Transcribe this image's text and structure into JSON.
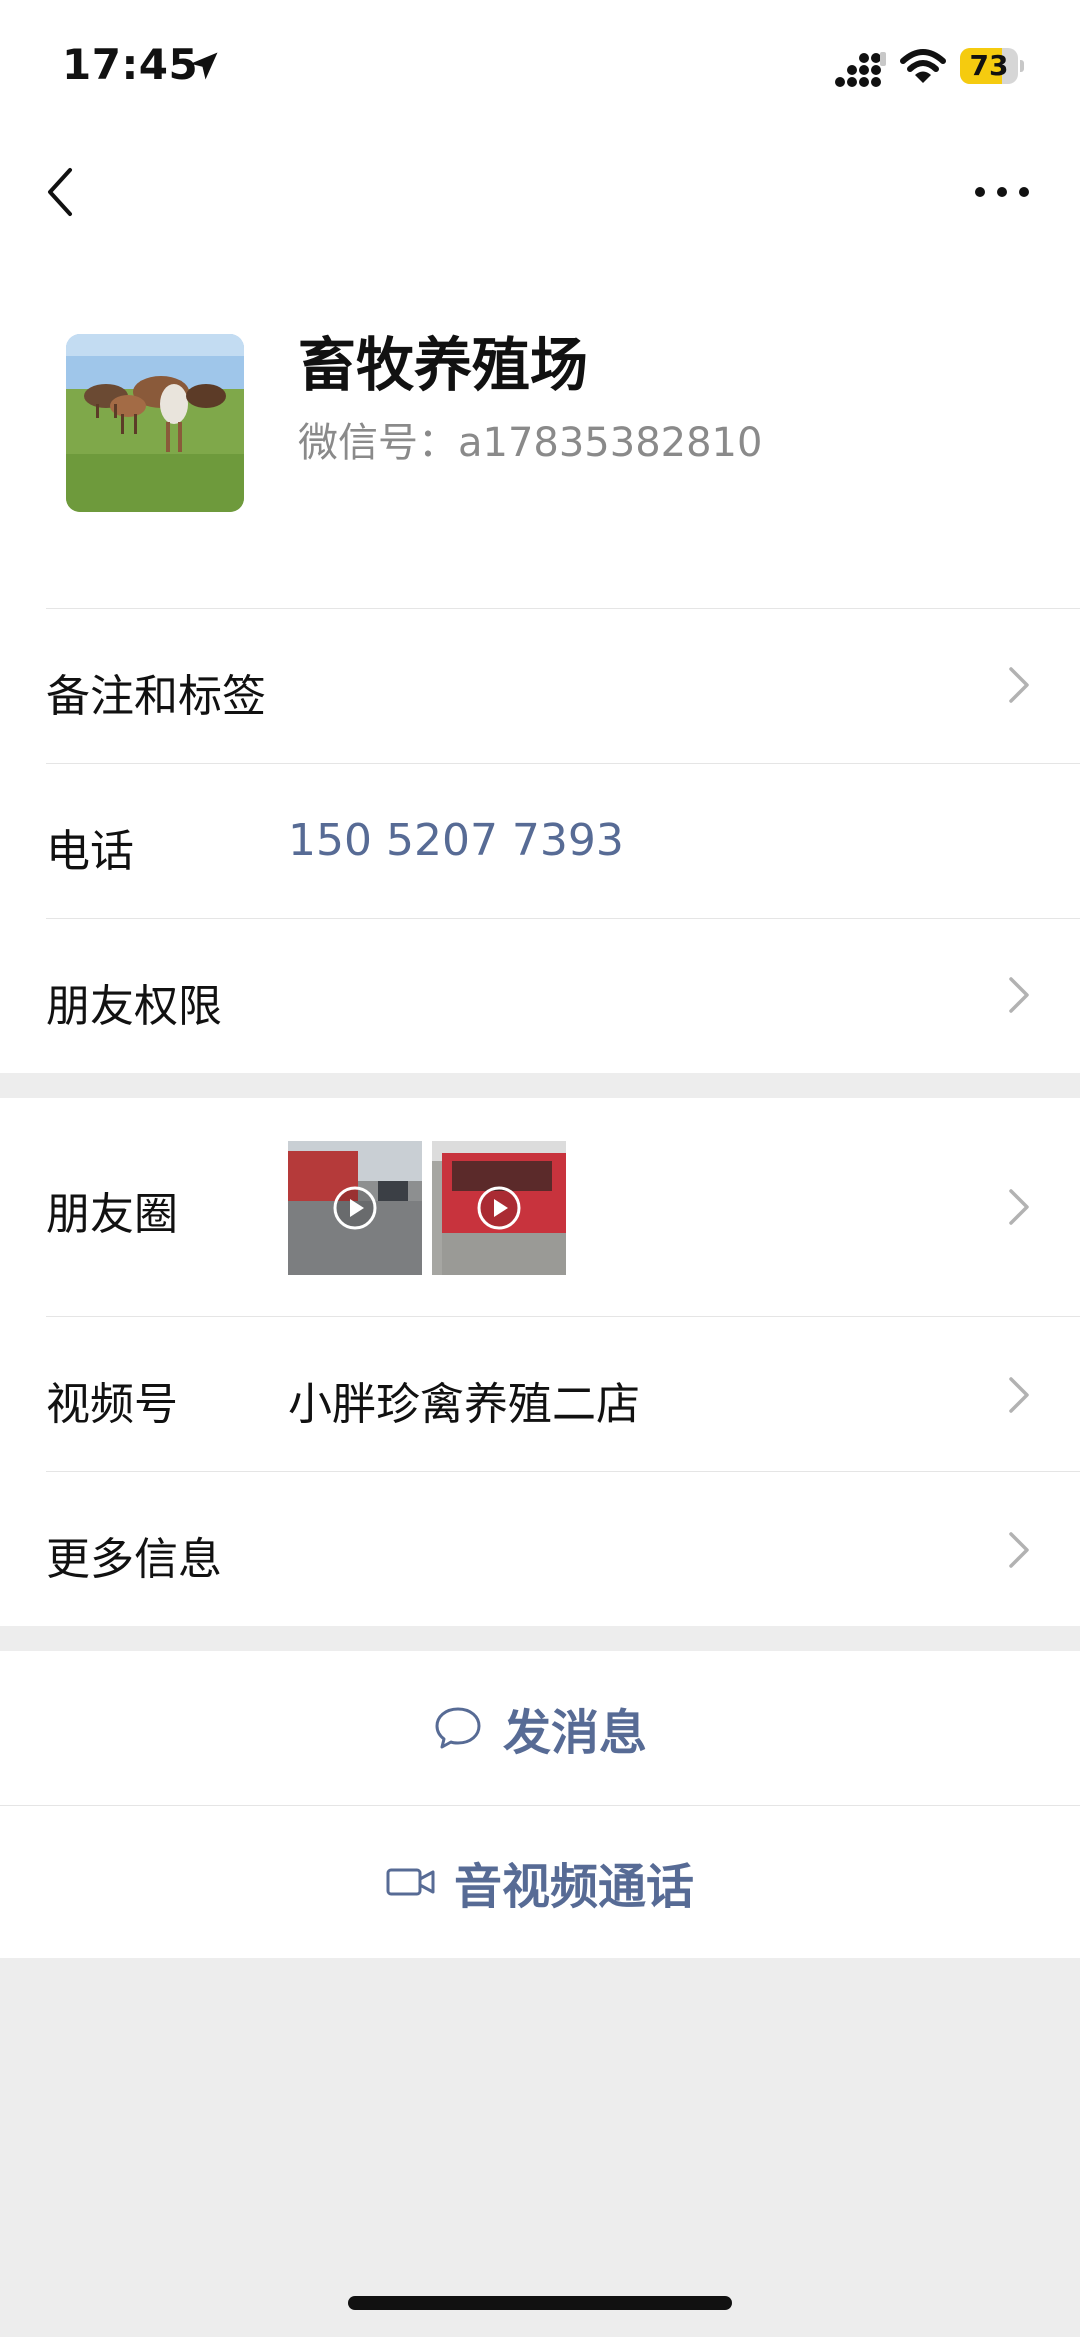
{
  "status_bar": {
    "time": "17:45",
    "battery": "73",
    "battery_level": 0.73
  },
  "nav": {
    "back": "back-icon",
    "more": "more-icon"
  },
  "profile": {
    "name": "畜牧养殖场",
    "wechat_id": "微信号：a17835382810"
  },
  "rows": {
    "remarks": {
      "label": "备注和标签"
    },
    "phone": {
      "label": "电话",
      "value": "150 5207 7393"
    },
    "permissions": {
      "label": "朋友权限"
    },
    "moments": {
      "label": "朋友圈"
    },
    "channels": {
      "label": "视频号",
      "value": "小胖珍禽养殖二店"
    },
    "more_info": {
      "label": "更多信息"
    }
  },
  "actions": {
    "message": {
      "label": "发消息",
      "icon": "chat-bubble-icon"
    },
    "call": {
      "label": "音视频通话",
      "icon": "video-camera-icon"
    }
  },
  "colors": {
    "link": "#576b95",
    "background": "#ededed",
    "battery": "#f5cb0f"
  }
}
